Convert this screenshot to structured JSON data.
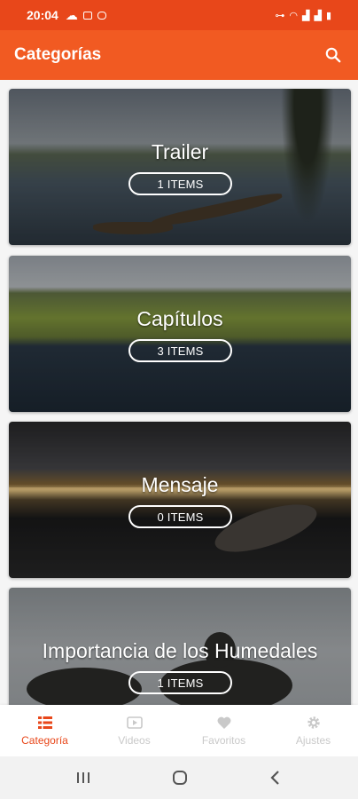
{
  "status_bar": {
    "time": "20:04",
    "left_icons": [
      "cloud-icon",
      "image-icon",
      "instagram-icon"
    ],
    "right_icons": [
      "hotspot-icon",
      "wifi-icon",
      "signal-icon",
      "signal-icon",
      "battery-icon"
    ]
  },
  "app_bar": {
    "title": "Categorías",
    "action_icon": "search-icon"
  },
  "categories": [
    {
      "name": "Trailer",
      "count": "1 ITEMS"
    },
    {
      "name": "Capítulos",
      "count": "3 ITEMS"
    },
    {
      "name": "Mensaje",
      "count": "0 ITEMS"
    },
    {
      "name": "Importancia de los Humedales",
      "count": "1 ITEMS"
    }
  ],
  "bottom_nav": [
    {
      "label": "Categoría",
      "icon": "list-icon",
      "active": true
    },
    {
      "label": "Videos",
      "icon": "play-icon",
      "active": false
    },
    {
      "label": "Favoritos",
      "icon": "heart-icon",
      "active": false
    },
    {
      "label": "Ajustes",
      "icon": "gear-icon",
      "active": false
    }
  ],
  "colors": {
    "status_bar": "#e8471a",
    "app_bar": "#f15a22",
    "accent": "#e8471a",
    "inactive": "#c9c9c9"
  }
}
